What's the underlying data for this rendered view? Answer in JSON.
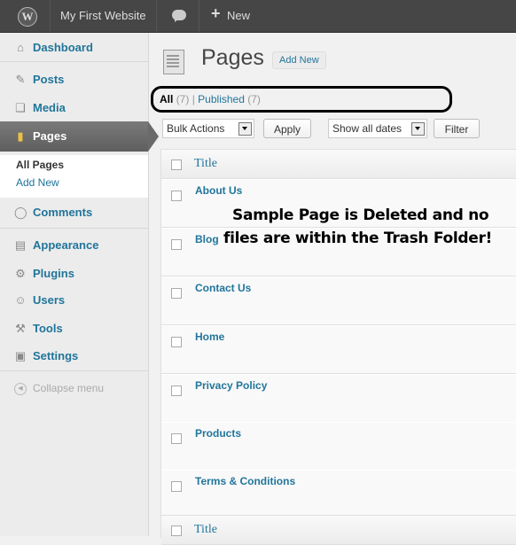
{
  "adminbar": {
    "logo": "W",
    "site_name": "My First Website",
    "comment_icon": "comment-bubble-icon",
    "new_icon": "+",
    "new_label": "New"
  },
  "sidebar": {
    "items": [
      {
        "label": "Dashboard",
        "icon": "⌂"
      },
      {
        "label": "Posts",
        "icon": "✎"
      },
      {
        "label": "Media",
        "icon": "❏"
      },
      {
        "label": "Pages",
        "icon": "▮"
      },
      {
        "label": "Comments",
        "icon": "◯"
      },
      {
        "label": "Appearance",
        "icon": "▤"
      },
      {
        "label": "Plugins",
        "icon": "⚙"
      },
      {
        "label": "Users",
        "icon": "☺"
      },
      {
        "label": "Tools",
        "icon": "⚒"
      },
      {
        "label": "Settings",
        "icon": "▣"
      }
    ],
    "submenu": {
      "all_pages": "All Pages",
      "add_new": "Add New"
    },
    "collapse": {
      "label": "Collapse menu",
      "icon": "◀"
    }
  },
  "main": {
    "title": "Pages",
    "add_new": "Add New",
    "filters": {
      "all": "All",
      "all_count": "(7)",
      "separator": "|",
      "published": "Published",
      "published_count": "(7)"
    },
    "bulk_actions": "Bulk Actions",
    "apply": "Apply",
    "dates": "Show all dates",
    "filter": "Filter",
    "column_title": "Title",
    "rows": [
      "About Us",
      "Blog",
      "Contact Us",
      "Home",
      "Privacy Policy",
      "Products",
      "Terms & Conditions"
    ],
    "annotation": [
      "Sample Page is Deleted and no",
      "files are within the Trash Folder!"
    ]
  },
  "colors": {
    "link": "#21759b",
    "adminbar": "#464646",
    "sidebar": "#ececec"
  }
}
